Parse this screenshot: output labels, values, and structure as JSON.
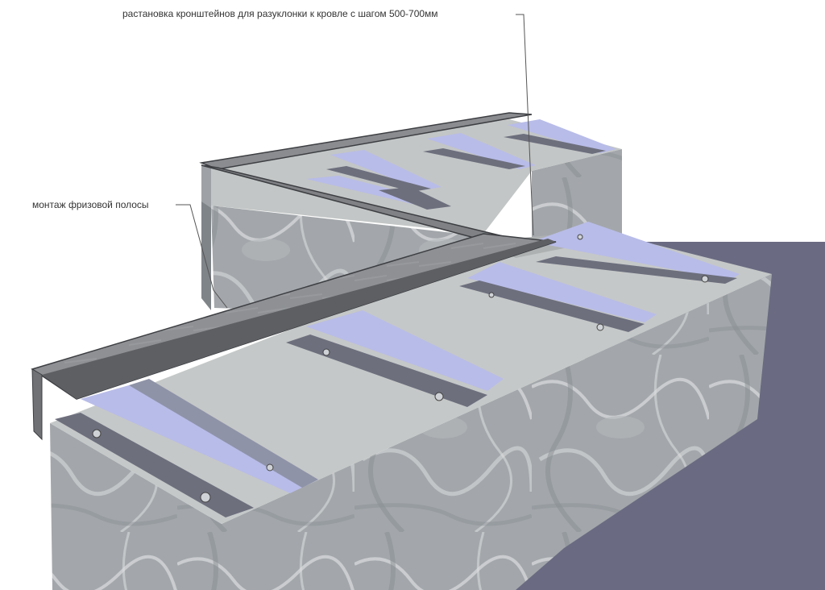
{
  "annotations": {
    "bracket_spacing": "растановка кронштейнов для разуклонки к кровле с шагом 500-700мм",
    "frieze_strip": "монтаж фризовой полосы"
  },
  "colors": {
    "stone": "#9ea3a7",
    "stone_dark": "#7b8085",
    "stone_light": "#c9cdd0",
    "top_surface": "#c5c8c8",
    "bracket_face": "#b8bce8",
    "bracket_strip": "#6d6f7d",
    "frieze": "#8a8c90",
    "frieze_edge": "#3c3e42",
    "ground": "#6a6b82"
  }
}
